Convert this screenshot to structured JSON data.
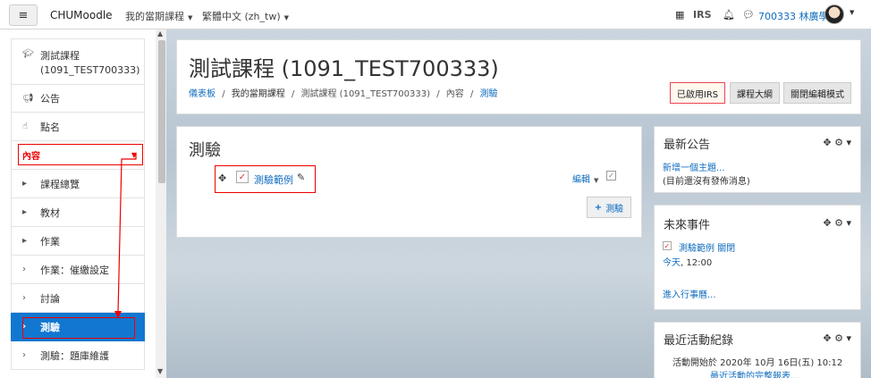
{
  "navbar": {
    "menu_icon": "hamburger-icon",
    "brand": "CHUMoodle",
    "my_courses": "我的當期課程",
    "language": "繁體中文 (zh_tw)",
    "grid_icon": "grid-icon",
    "irs": "IRS",
    "bell_icon": "bell-icon",
    "chat_icon": "chat-icon",
    "user": "700333 林廣學"
  },
  "drawer": {
    "course_name": "測試課程",
    "course_code": "(1091_TEST700333)",
    "items": [
      {
        "label": "公告",
        "icon": "megaphone-icon"
      },
      {
        "label": "點名",
        "icon": "hand-icon"
      },
      {
        "label": "內容"
      },
      {
        "label": "課程總覽",
        "icon": "chevron-right-icon"
      },
      {
        "label": "教材",
        "icon": "chevron-right-icon"
      },
      {
        "label": "作業",
        "icon": "chevron-right-icon"
      },
      {
        "label": "作業：催繳設定",
        "icon": "chevron-right-icon"
      },
      {
        "label": "討論",
        "icon": "chevron-right-icon"
      },
      {
        "label": "測驗",
        "icon": "chevron-right-icon"
      },
      {
        "label": "測驗：題庫維護",
        "icon": "chevron-right-icon"
      }
    ]
  },
  "header": {
    "title": "測試課程 (1091_TEST700333)",
    "breadcrumb": [
      "儀表板",
      "我的當期課程",
      "測試課程 (1091_TEST700333)",
      "內容",
      "測驗"
    ],
    "buttons": [
      "已啟用IRS",
      "課程大綱",
      "關閉編輯模式"
    ]
  },
  "section": {
    "title": "測驗",
    "activity": "測驗範例",
    "edit": "編輯",
    "add": "測驗"
  },
  "blocks": {
    "news": {
      "title": "最新公告",
      "link": "新增一個主題...",
      "note": "(目前還沒有發佈消息)"
    },
    "events": {
      "title": "未來事件",
      "event": "測驗範例 關閉",
      "date_link": "今天",
      "time": ", 12:00",
      "calendar": "進入行事曆..."
    },
    "activity": {
      "title": "最近活動紀錄",
      "since": "活動開始於 2020年 10月 16日(五) 10:12",
      "report": "最近活動的完整報表..."
    }
  },
  "colors": {
    "accent": "#0f6cbf",
    "active": "#1177d1",
    "highlight": "#e00000"
  }
}
